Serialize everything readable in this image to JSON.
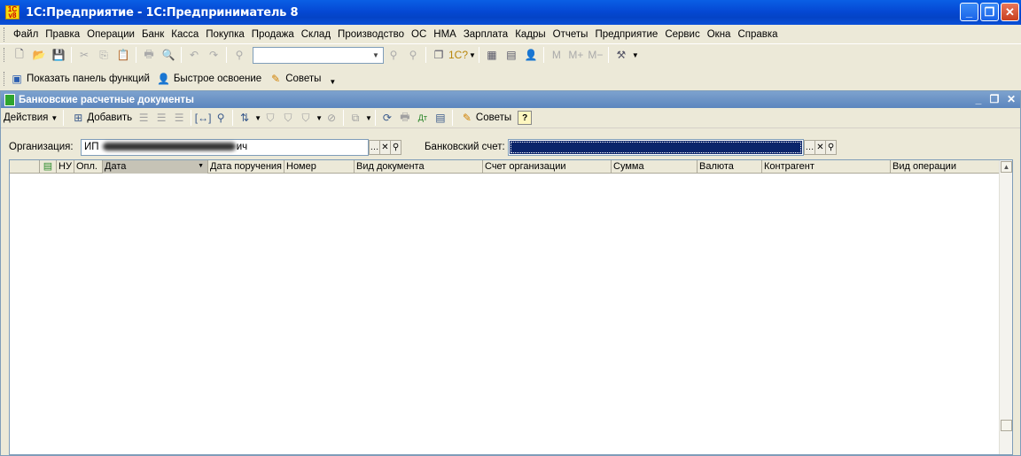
{
  "window": {
    "title": "1С:Предприятие - 1С:Предприниматель 8",
    "app_icon_text": "1С\nv8"
  },
  "menu": [
    {
      "label": "Файл"
    },
    {
      "label": "Правка"
    },
    {
      "label": "Операции"
    },
    {
      "label": "Банк"
    },
    {
      "label": "Касса"
    },
    {
      "label": "Покупка"
    },
    {
      "label": "Продажа"
    },
    {
      "label": "Склад"
    },
    {
      "label": "Производство"
    },
    {
      "label": "ОС"
    },
    {
      "label": "НМА"
    },
    {
      "label": "Зарплата"
    },
    {
      "label": "Кадры"
    },
    {
      "label": "Отчеты"
    },
    {
      "label": "Предприятие"
    },
    {
      "label": "Сервис"
    },
    {
      "label": "Окна"
    },
    {
      "label": "Справка"
    }
  ],
  "toolbar": {
    "search_combo_value": "",
    "memory_buttons": [
      "M",
      "M+",
      "M−"
    ]
  },
  "funcbar": {
    "show_panel": "Показать панель функций",
    "quick_learn": "Быстрое освоение",
    "tips": "Советы"
  },
  "document": {
    "title": "Банковские расчетные документы",
    "actions_label": "Действия",
    "add_label": "Добавить",
    "tips_label": "Советы",
    "help_label": "?",
    "filters": {
      "org_label": "Организация:",
      "org_value_prefix": "ИП",
      "org_value_suffix": "ич",
      "bank_account_label": "Банковский счет:"
    },
    "columns": [
      {
        "label": "",
        "icon": "document-icon"
      },
      {
        "label": "НУ"
      },
      {
        "label": "Опл."
      },
      {
        "label": "Дата",
        "sorted": true
      },
      {
        "label": "Дата поручения"
      },
      {
        "label": "Номер"
      },
      {
        "label": "Вид документа"
      },
      {
        "label": "Счет организации"
      },
      {
        "label": "Сумма"
      },
      {
        "label": "Валюта"
      },
      {
        "label": "Контрагент"
      },
      {
        "label": "Вид операции"
      }
    ],
    "rows": []
  }
}
